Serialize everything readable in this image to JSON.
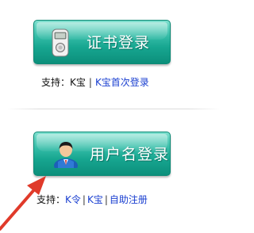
{
  "cert_login": {
    "label": "证书登录",
    "icon": "usb-key-icon",
    "support": {
      "prefix": "支持：",
      "plain_item": "K宝",
      "separator": "|",
      "link": "K宝首次登录"
    }
  },
  "user_login": {
    "label": "用户名登录",
    "icon": "user-avatar-icon",
    "support": {
      "prefix": "支持：",
      "links": [
        "K令",
        "K宝",
        "自助注册"
      ],
      "separator": "|"
    }
  },
  "colors": {
    "button": "#17a690",
    "link": "#1a3fd0",
    "annotation_arrow": "#e03a2a"
  }
}
